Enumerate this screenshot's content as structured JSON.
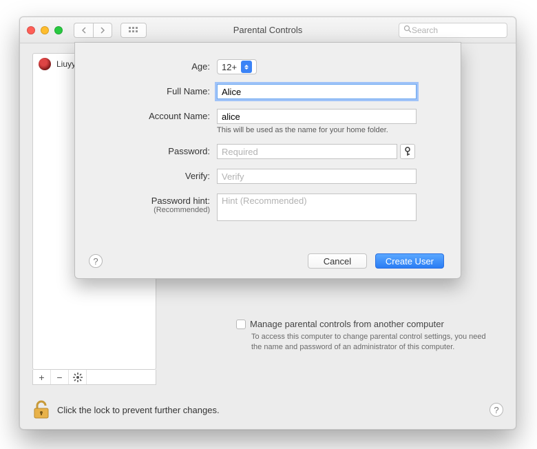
{
  "window": {
    "title": "Parental Controls",
    "search_placeholder": "Search"
  },
  "sidebar": {
    "users": [
      {
        "name": "Liuyy"
      }
    ],
    "footer": {
      "add": "+",
      "remove": "−",
      "gear": "✻"
    }
  },
  "manage": {
    "label": "Manage parental controls from another computer",
    "desc": "To access this computer to change parental control settings, you need the name and password of an administrator of this computer."
  },
  "lock": {
    "text": "Click the lock to prevent further changes."
  },
  "sheet": {
    "labels": {
      "age": "Age:",
      "full_name": "Full Name:",
      "account_name": "Account Name:",
      "password": "Password:",
      "verify": "Verify:",
      "password_hint": "Password hint:",
      "recommended": "(Recommended)"
    },
    "values": {
      "age_selected": "12+",
      "full_name": "Alice",
      "account_name": "alice",
      "password": "",
      "verify": "",
      "hint": ""
    },
    "placeholders": {
      "password": "Required",
      "verify": "Verify",
      "hint": "Hint (Recommended)"
    },
    "notes": {
      "account_name": "This will be used as the name for your home folder."
    },
    "buttons": {
      "cancel": "Cancel",
      "create": "Create User"
    }
  }
}
